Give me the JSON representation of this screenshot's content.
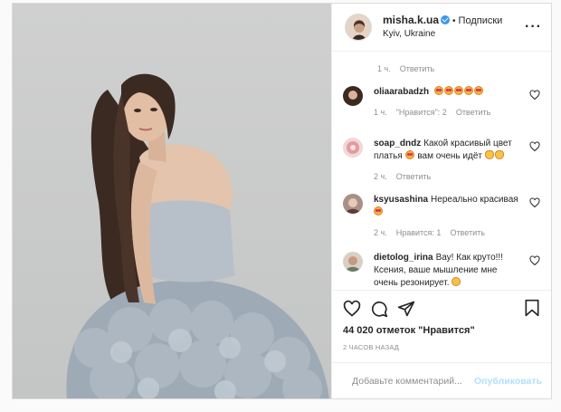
{
  "post": {
    "username": "misha.k.ua",
    "separator": "•",
    "follow_label": "Подписки",
    "location": "Kyiv, Ukraine",
    "more_icon": "more-horizontal-icon"
  },
  "top_meta": {
    "time": "1 ч.",
    "reply": "Ответить"
  },
  "comments": [
    {
      "user": "oliaarabadzh",
      "text": "",
      "emojis": [
        "love",
        "love",
        "love",
        "love",
        "love"
      ],
      "time": "1 ч.",
      "likes": "\"Нравится\": 2",
      "reply": "Ответить",
      "avatar_color": "#3a2a22"
    },
    {
      "user": "soap_dndz",
      "text": "Какой красивый цвет платья",
      "text2": "вам очень идёт",
      "time": "2 ч.",
      "likes": "",
      "reply": "Ответить",
      "avatar_color": "#e9a6a6"
    },
    {
      "user": "ksyusashina",
      "text": "Нереально красивая",
      "time": "2 ч.",
      "likes": "Нравится: 1",
      "reply": "Ответить",
      "avatar_color": "#6b5a55"
    },
    {
      "user": "dietolog_irina",
      "text": "Вау! Как круто!!! Ксения, ваше мышление мне очень резонирует.",
      "time": "",
      "likes": "",
      "reply": "",
      "avatar_color": "#b8a08a"
    }
  ],
  "likes_count": "44 020 отметок \"Нравится\"",
  "time_ago": "2 ЧАСОВ НАЗАД",
  "add_comment": {
    "placeholder": "Добавьте комментарий...",
    "post_label": "Опубликовать"
  },
  "colors": {
    "verified": "#3897f0",
    "post_disabled": "#b2dffc",
    "muted": "#8e8e8e"
  }
}
